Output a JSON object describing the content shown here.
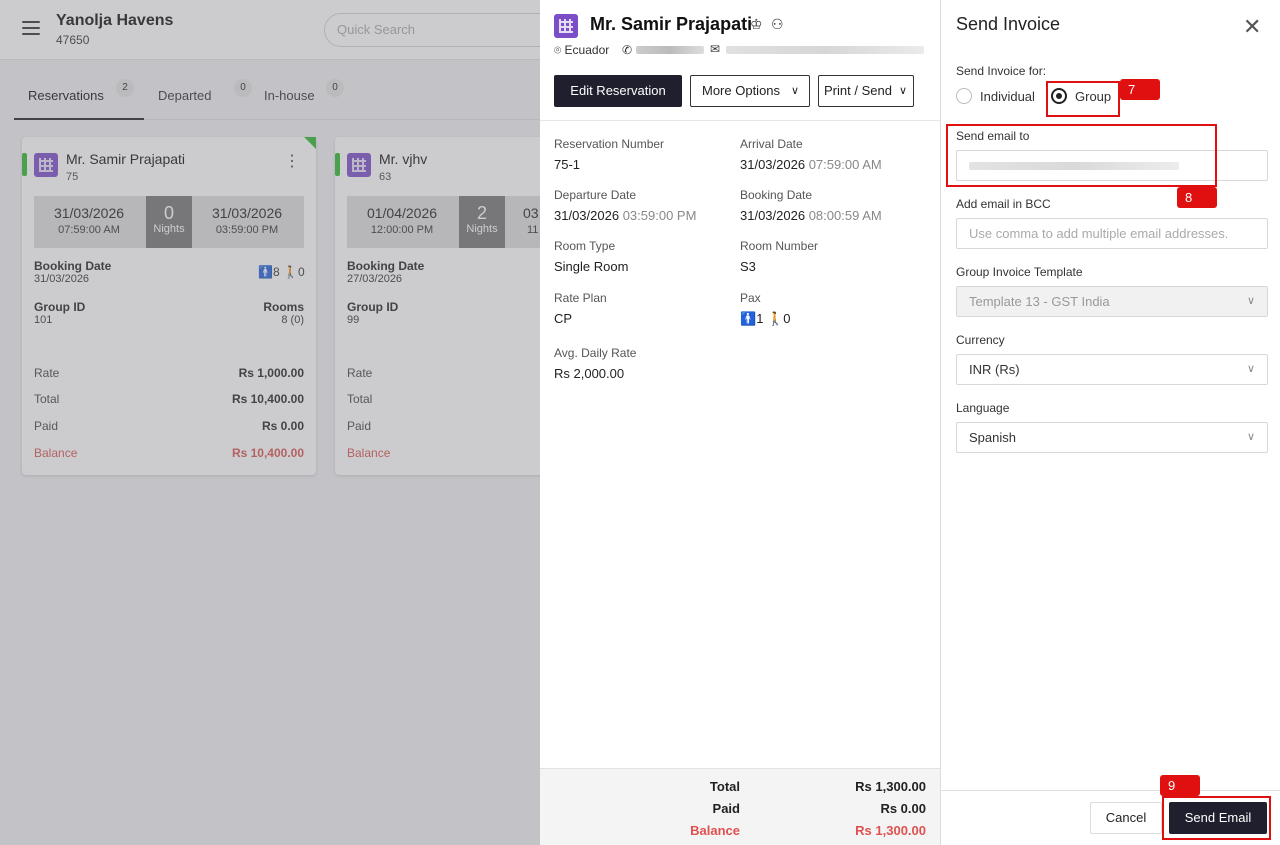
{
  "app": {
    "hotel_name": "Yanolja Havens",
    "hotel_id": "47650",
    "search_placeholder": "Quick Search"
  },
  "tabs": [
    {
      "label": "Reservations",
      "count": "2"
    },
    {
      "label": "Departed",
      "count": "0"
    },
    {
      "label": "In-house",
      "count": "0"
    }
  ],
  "cards": [
    {
      "name": "Mr. Samir Prajapati",
      "number": "75",
      "arr_date": "31/03/2026",
      "arr_time": "07:59:00 AM",
      "nights": "0",
      "nights_label": "Nights",
      "dep_date": "31/03/2026",
      "dep_time": "03:59:00 PM",
      "booking_label": "Booking Date",
      "booking_date": "31/03/2026",
      "adults": "8",
      "children": "0",
      "group_label": "Group ID",
      "group_id": "101",
      "rooms_label": "Rooms",
      "rooms": "8 (0)",
      "rate_label": "Rate",
      "rate": "Rs 1,000.00",
      "total_label": "Total",
      "total": "Rs 10,400.00",
      "paid_label": "Paid",
      "paid": "Rs 0.00",
      "balance_label": "Balance",
      "balance": "Rs 10,400.00"
    },
    {
      "name": "Mr. vjhv",
      "number": "63",
      "arr_date": "01/04/2026",
      "arr_time": "12:00:00 PM",
      "nights": "2",
      "nights_label": "Nights",
      "dep_date": "03",
      "dep_time": "11",
      "booking_label": "Booking Date",
      "booking_date": "27/03/2026",
      "group_label": "Group ID",
      "group_id": "99",
      "rate_label": "Rate",
      "total_label": "Total",
      "paid_label": "Paid",
      "balance_label": "Balance"
    }
  ],
  "reservation": {
    "guest_name": "Mr. Samir Prajapati",
    "country": "Ecuador",
    "edit_button": "Edit Reservation",
    "more_options": "More Options",
    "print_send": "Print / Send",
    "fields": {
      "res_number_label": "Reservation Number",
      "res_number": "75-1",
      "arrival_label": "Arrival Date",
      "arrival_date": "31/03/2026",
      "arrival_time": "07:59:00 AM",
      "departure_label": "Departure Date",
      "departure_date": "31/03/2026",
      "departure_time": "03:59:00 PM",
      "booking_label": "Booking Date",
      "booking_date": "31/03/2026",
      "booking_time": "08:00:59 AM",
      "room_type_label": "Room Type",
      "room_type": "Single Room",
      "room_number_label": "Room Number",
      "room_number": "S3",
      "rate_plan_label": "Rate Plan",
      "rate_plan": "CP",
      "pax_label": "Pax",
      "pax_adults": "1",
      "pax_children": "0",
      "adr_label": "Avg. Daily Rate",
      "adr": "Rs 2,000.00"
    },
    "totals": {
      "total_label": "Total",
      "total": "Rs 1,300.00",
      "paid_label": "Paid",
      "paid": "Rs 0.00",
      "balance_label": "Balance",
      "balance": "Rs 1,300.00"
    }
  },
  "invoice": {
    "title": "Send Invoice",
    "for_label": "Send Invoice for:",
    "opt_individual": "Individual",
    "opt_group": "Group",
    "email_label": "Send email to",
    "bcc_label": "Add email in BCC",
    "bcc_placeholder": "Use comma to add multiple email addresses.",
    "template_label": "Group Invoice Template",
    "template_value": "Template 13 - GST India",
    "currency_label": "Currency",
    "currency_value": "INR (Rs)",
    "language_label": "Language",
    "language_value": "Spanish",
    "cancel": "Cancel",
    "send": "Send Email"
  },
  "annotations": {
    "a7": "7",
    "a8": "8",
    "a9": "9"
  },
  "colors": {
    "accent_dark": "#1f1f2e",
    "highlight": "#e01010",
    "balance_red": "#e05050",
    "status_green": "#2eb82e",
    "brand_purple": "#7b4ec8"
  }
}
